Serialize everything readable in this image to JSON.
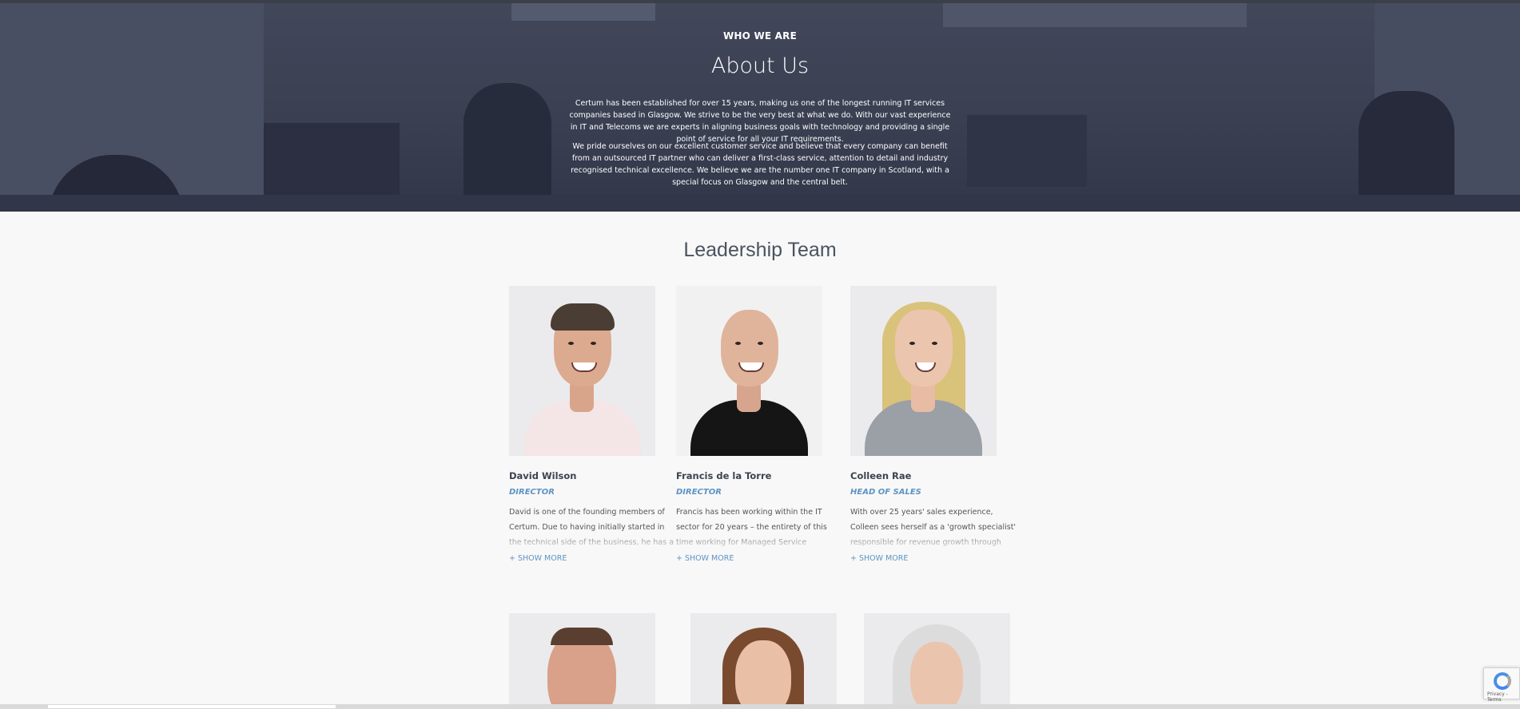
{
  "hero": {
    "kicker": "WHO WE ARE",
    "title": "About Us",
    "paragraph1": "Certum has been established for over 15 years, making us one of the longest running IT services companies based in Glasgow. We strive to be the very best at what we do. With our vast experience in IT and Telecoms we are experts in aligning business goals with technology and providing a single point of service for all your IT requirements.",
    "paragraph2": "We pride ourselves on our excellent customer service and believe that every company can benefit from an outsourced IT partner who can deliver a first-class service, attention to detail and industry recognised technical excellence. We believe we are the number one IT company in Scotland, with a special focus on Glasgow and the central belt."
  },
  "leadership": {
    "title": "Leadership Team",
    "members": [
      {
        "name": "David Wilson",
        "role": "DIRECTOR",
        "bio": "David is one of the founding members of Certum. Due to having initially started in the technical side of the business, he has a strong",
        "more": "+ SHOW MORE"
      },
      {
        "name": "Francis de la Torre",
        "role": "DIRECTOR",
        "bio": "Francis has been working within the IT sector for 20 years – the entirety of this time working for Managed Service Providers. Francis has",
        "more": "+ SHOW MORE"
      },
      {
        "name": "Colleen Rae",
        "role": "HEAD OF SALES",
        "bio": "With over 25 years' sales experience, Colleen sees herself as a 'growth specialist' responsible for revenue growth through business development",
        "more": "+ SHOW MORE"
      }
    ]
  },
  "recaptcha": {
    "text": "Privacy - Terms"
  },
  "colors": {
    "accent": "#5d94c4",
    "heading": "#4b5360",
    "hero_overlay": "#292e42"
  }
}
